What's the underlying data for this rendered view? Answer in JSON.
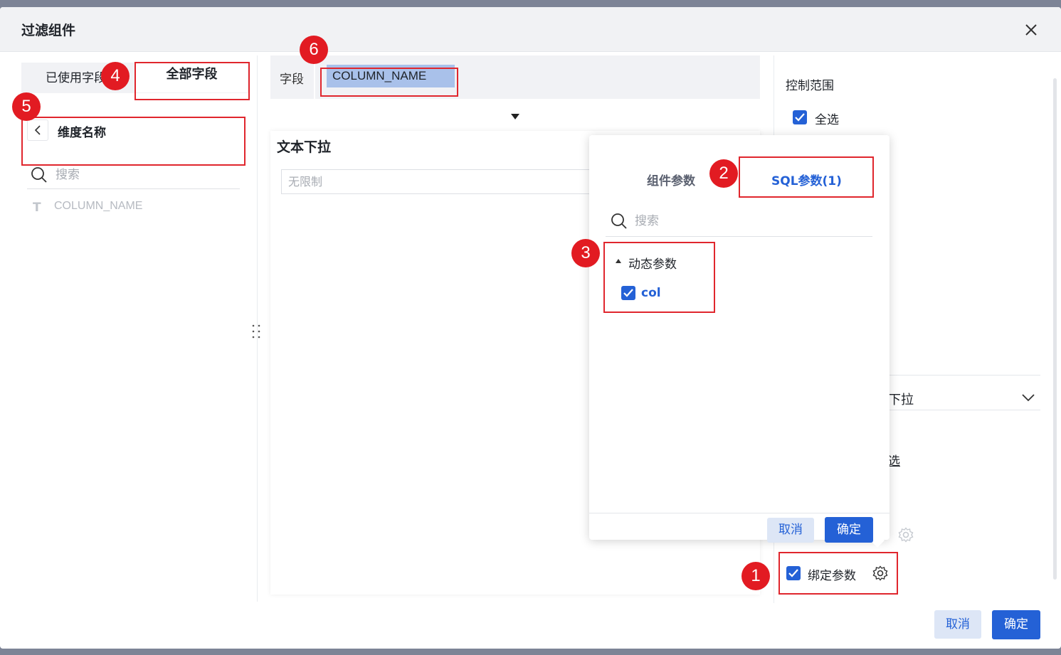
{
  "dialog": {
    "title": "过滤组件"
  },
  "left": {
    "tab_used": "已使用字段",
    "tab_all": "全部字段",
    "back_title": "维度名称",
    "search_placeholder": "搜索",
    "field_items": [
      {
        "icon": "T",
        "name": "COLUMN_NAME"
      }
    ]
  },
  "center": {
    "field_label": "字段",
    "field_value": "COLUMN_NAME",
    "widget_title": "文本下拉",
    "widget_placeholder": "无限制"
  },
  "right": {
    "control_range_label": "控制范围",
    "select_all_label": "全选",
    "select_all_checked": true,
    "partial_dropdown_text": "下拉",
    "partial_text": "选",
    "bind_param_label": "绑定参数",
    "bind_param_checked": true
  },
  "popup": {
    "tab_component_params": "组件参数",
    "tab_sql_params": "SQL参数(1)",
    "search_placeholder": "搜索",
    "group_label": "动态参数",
    "param_item": "col",
    "param_checked": true,
    "cancel_label": "取消",
    "confirm_label": "确定"
  },
  "footer": {
    "cancel_label": "取消",
    "confirm_label": "确定"
  },
  "annotations": [
    "1",
    "2",
    "3",
    "4",
    "5",
    "6"
  ],
  "colors": {
    "accent": "#2461d6",
    "annotation_red": "#e21b22",
    "chip_bg": "#a9c1ea"
  }
}
